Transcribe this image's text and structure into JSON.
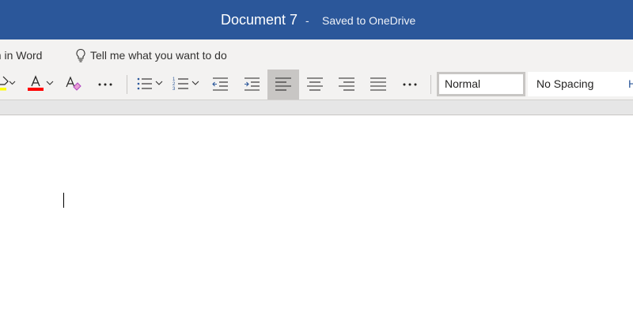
{
  "titlebar": {
    "document_title": "Document 7",
    "separator": "-",
    "save_status": "Saved to OneDrive",
    "background": "#2b579a"
  },
  "menubar": {
    "open_in_word": "en in Word",
    "tell_me": "Tell me what you want to do",
    "tell_me_icon": "lightbulb-icon"
  },
  "ribbon": {
    "more_label": "···",
    "active_button": "align-left",
    "icons": [
      "highlight-icon",
      "font-color-icon",
      "clear-formatting-icon",
      "more-icon",
      "bullets-icon",
      "numbering-icon",
      "decrease-indent-icon",
      "increase-indent-icon",
      "align-left-icon",
      "align-center-icon",
      "align-right-icon",
      "justify-icon",
      "more-icon"
    ],
    "colors": {
      "highlight": "#ffff00",
      "font_color": "#ff0000"
    }
  },
  "styles": {
    "selected": "Normal",
    "items": [
      "Normal",
      "No Spacing",
      "H"
    ]
  }
}
